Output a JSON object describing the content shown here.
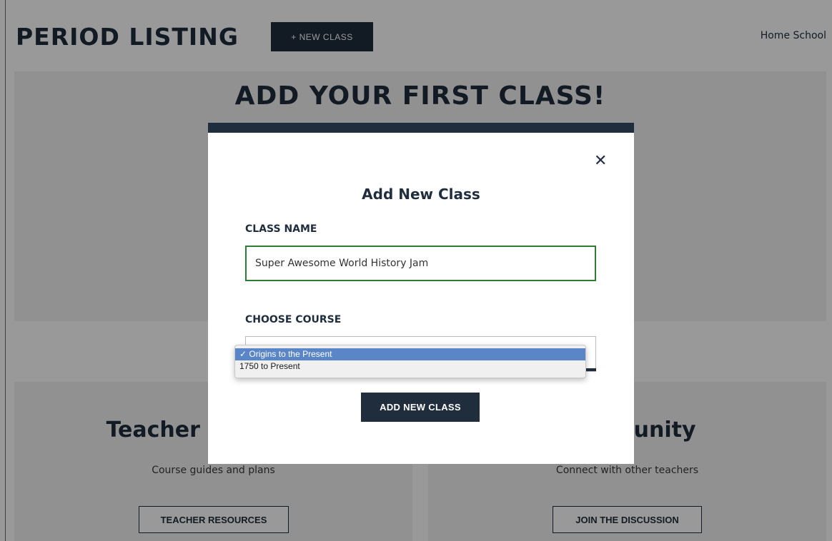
{
  "header": {
    "title": "PERIOD LISTING",
    "new_class_label": "+ NEW CLASS",
    "school_name": "Home School"
  },
  "hero": {
    "title": "ADD YOUR FIRST CLASS!"
  },
  "cards": [
    {
      "title": "Teacher Resources",
      "subtitle": "Course guides and plans",
      "button_label": "TEACHER RESOURCES"
    },
    {
      "title": "Community",
      "subtitle": "Connect with other teachers",
      "button_label": "JOIN THE DISCUSSION"
    }
  ],
  "modal": {
    "close_icon": "close-icon",
    "close_glyph": "✕",
    "title": "Add New Class",
    "class_name_label": "CLASS NAME",
    "class_name_value": "Super Awesome World History Jam",
    "choose_course_label": "CHOOSE COURSE",
    "course_options": [
      {
        "label": "✓ Origins to the Present",
        "selected": true
      },
      {
        "label": "1750 to Present",
        "selected": false
      }
    ],
    "submit_label": "ADD NEW CLASS"
  },
  "colors": {
    "brand_navy": "#1f2d3d",
    "input_focus_border": "#2e7d32",
    "dropdown_highlight": "#5a86c8"
  }
}
